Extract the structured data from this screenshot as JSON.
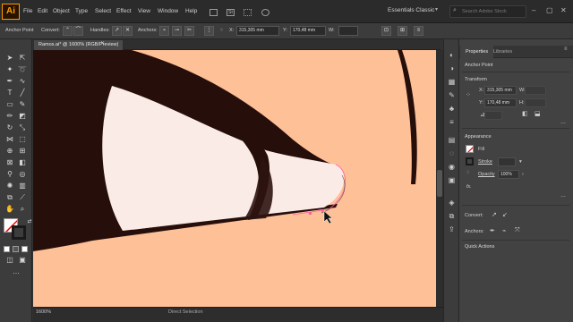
{
  "app": {
    "logo": "Ai"
  },
  "menu": [
    "File",
    "Edit",
    "Object",
    "Type",
    "Select",
    "Effect",
    "View",
    "Window",
    "Help"
  ],
  "workspace": {
    "label": "Essentials Classic"
  },
  "search": {
    "placeholder": "Search Adobe Stock"
  },
  "control_bar": {
    "mode_label": "Anchor Point",
    "convert_label": "Convert:",
    "handles_label": "Handles:",
    "anchors_label": "Anchors:",
    "x_label": "X:",
    "x_value": "315,305 mm",
    "y_label": "Y:",
    "y_value": "170,48 mm",
    "w_label": "W:"
  },
  "document": {
    "tab_title": "Ramos.ai* @ 1600% (RGB/Preview)",
    "zoom": "1600%",
    "status": "Direct Selection"
  },
  "panel": {
    "tabs": [
      "Properties",
      "Libraries"
    ],
    "selection_type": "Anchor Point",
    "transform": {
      "title": "Transform",
      "x_label": "X:",
      "x_value": "315,305 mm",
      "y_label": "Y:",
      "y_value": "170,48 mm",
      "w_label": "W:",
      "h_label": "H:"
    },
    "appearance": {
      "title": "Appearance",
      "fill_label": "Fill",
      "stroke_label": "Stroke",
      "opacity_label": "Opacity",
      "opacity_value": "100%",
      "fx_label": "fx."
    },
    "convert_label": "Convert:",
    "anchors_label": "Anchors:",
    "quick_actions_title": "Quick Actions"
  },
  "colors": {
    "skin": "#fec096",
    "eye_dark": "#260e0b",
    "eye_white": "#fbebe7",
    "selection_pink": "#ff5fa8",
    "accent_orange": "#ff9a00"
  }
}
